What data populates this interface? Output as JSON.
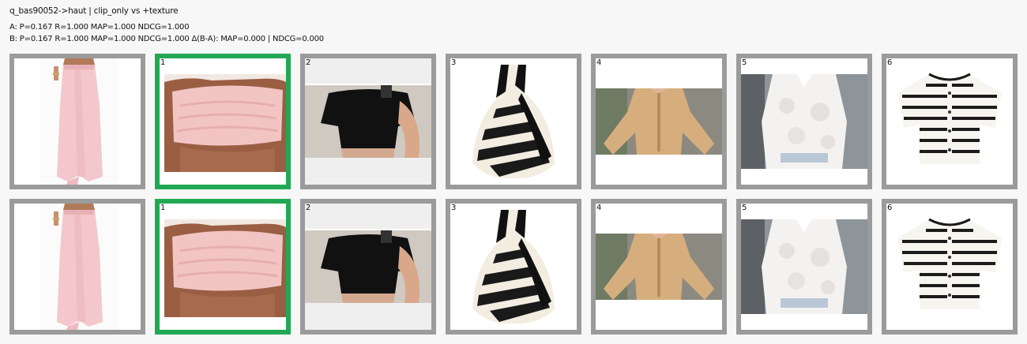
{
  "header": {
    "title": "q_bas90052->haut | clip_only vs +texture",
    "lineA": "A: P=0.167  R=1.000  MAP=1.000  NDCG=1.000",
    "lineB": "B: P=0.167  R=1.000  MAP=1.000  NDCG=1.000  Δ(B-A): MAP=0.000 | NDCG=0.000"
  },
  "colors": {
    "relevant_border": "#22a855",
    "default_border": "#9b9b9b",
    "background": "#f7f7f7"
  },
  "rows": [
    {
      "label": "A",
      "query": {
        "image": "pink-maxi-skirt"
      },
      "results": [
        {
          "rank": "1",
          "image": "pink-strapless-tube-top",
          "relevant": true
        },
        {
          "rank": "2",
          "image": "black-cropped-tee",
          "relevant": false
        },
        {
          "rank": "3",
          "image": "zebra-halter-top",
          "relevant": false
        },
        {
          "rank": "4",
          "image": "tan-cardigan",
          "relevant": false
        },
        {
          "rank": "5",
          "image": "white-floral-blouse",
          "relevant": false
        },
        {
          "rank": "6",
          "image": "striped-knit-cardigan",
          "relevant": false
        }
      ]
    },
    {
      "label": "B",
      "query": {
        "image": "pink-maxi-skirt"
      },
      "results": [
        {
          "rank": "1",
          "image": "pink-strapless-tube-top",
          "relevant": true
        },
        {
          "rank": "2",
          "image": "black-cropped-tee",
          "relevant": false
        },
        {
          "rank": "3",
          "image": "zebra-halter-top",
          "relevant": false
        },
        {
          "rank": "4",
          "image": "tan-cardigan",
          "relevant": false
        },
        {
          "rank": "5",
          "image": "white-floral-blouse",
          "relevant": false
        },
        {
          "rank": "6",
          "image": "striped-knit-cardigan",
          "relevant": false
        }
      ]
    }
  ]
}
